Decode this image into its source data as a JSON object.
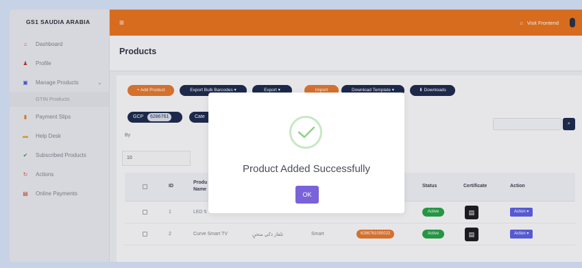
{
  "sidebar": {
    "brand": "GS1 SAUDIA ARABIA",
    "items": [
      {
        "label": "Dashboard",
        "icon": "home-icon",
        "glyph": "⌂",
        "color": "#d9534f"
      },
      {
        "label": "Profile",
        "icon": "user-icon",
        "glyph": "♟",
        "color": "#c0392b"
      },
      {
        "label": "Manage Products",
        "icon": "box-icon",
        "glyph": "▣",
        "color": "#4a57c9"
      },
      {
        "label": "Payment Slips",
        "icon": "receipt-icon",
        "glyph": "▮",
        "color": "#e67e22"
      },
      {
        "label": "Help Desk",
        "icon": "help-icon",
        "glyph": "▬",
        "color": "#e0a020"
      },
      {
        "label": "Subscribed Products",
        "icon": "check-icon",
        "glyph": "✔",
        "color": "#2e9e3e"
      },
      {
        "label": "Actions",
        "icon": "refresh-icon",
        "glyph": "↻",
        "color": "#d9534f"
      },
      {
        "label": "Online Payments",
        "icon": "card-icon",
        "glyph": "▤",
        "color": "#c0392b"
      }
    ],
    "sub_item": "GTIN Products"
  },
  "topbar": {
    "menu_glyph": "≡",
    "visit_label": "Visit Frontend",
    "home_glyph": "⌂"
  },
  "page": {
    "title": "Products"
  },
  "toolbar": {
    "add_product": "+ Add Product",
    "export_bulk": "Export Bulk Barcodes ▾",
    "export": "Export ▾",
    "import": "Import",
    "download_template": "Download Template ▾",
    "downloads": "⬇ Downloads"
  },
  "filters": {
    "gcp_label": "GCP",
    "gcp_value": "6286761",
    "category_label": "Cate",
    "by_label": "By",
    "entries_value": "10",
    "search_glyph": "🔍"
  },
  "table": {
    "headers": {
      "id": "ID",
      "product_name": "Produ\nName",
      "status": "Status",
      "certificate": "Certificate",
      "action": "Action"
    },
    "rows": [
      {
        "id": "1",
        "name": "LED 5",
        "arabic": "",
        "brand": "",
        "gtin": "",
        "status": "Active",
        "action": "Action ▾"
      },
      {
        "id": "2",
        "name": "Curve Smart TV",
        "arabic": "تلفاز ذكي منحنٍ",
        "brand": "Smart",
        "gtin": "6286761000022",
        "status": "Active",
        "action": "Action ▾"
      }
    ],
    "doc_glyph": "▤"
  },
  "modal": {
    "title": "Product Added Successfully",
    "ok": "OK",
    "icon": "success-check-icon",
    "accent": "#7a62d8"
  },
  "colors": {
    "brand_orange": "#e6721e",
    "navy": "#1d2a4c",
    "success": "#27a046"
  }
}
